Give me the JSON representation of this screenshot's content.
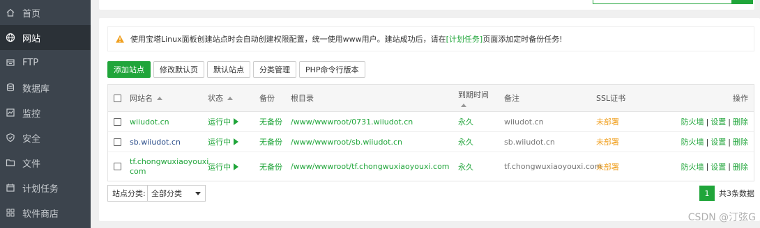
{
  "sidebar": {
    "items": [
      {
        "label": "首页",
        "icon": "home-icon"
      },
      {
        "label": "网站",
        "icon": "globe-icon",
        "active": true
      },
      {
        "label": "FTP",
        "icon": "ftp-icon"
      },
      {
        "label": "数据库",
        "icon": "database-icon"
      },
      {
        "label": "监控",
        "icon": "monitor-icon"
      },
      {
        "label": "安全",
        "icon": "shield-icon"
      },
      {
        "label": "文件",
        "icon": "folder-icon"
      },
      {
        "label": "计划任务",
        "icon": "calendar-icon"
      },
      {
        "label": "软件商店",
        "icon": "grid-icon"
      }
    ]
  },
  "notice": {
    "text_before": "使用宝塔Linux面板创建站点时会自动创建权限配置，统一使用www用户。建站成功后，请在",
    "link": "[计划任务]",
    "text_after": "页面添加定时备份任务!"
  },
  "toolbar": {
    "add_site": "添加站点",
    "edit_default_page": "修改默认页",
    "default_site": "默认站点",
    "category_manage": "分类管理",
    "php_cli_version": "PHP命令行版本"
  },
  "table": {
    "headers": {
      "name": "网站名",
      "status": "状态",
      "backup": "备份",
      "root": "根目录",
      "expire": "到期时间",
      "note": "备注",
      "ssl": "SSL证书",
      "ops": "操作"
    },
    "rows": [
      {
        "name": "wiiudot.cn",
        "status": "运行中",
        "backup": "无备份",
        "root": "/www/wwwroot/0731.wiiudot.cn",
        "expire": "永久",
        "note": "wiiudot.cn",
        "ssl": "未部署",
        "ops": [
          "防火墙",
          "设置",
          "删除"
        ]
      },
      {
        "name": "sb.wiiudot.cn",
        "status": "运行中",
        "backup": "无备份",
        "root": "/www/wwwroot/sb.wiiudot.cn",
        "expire": "永久",
        "note": "sb.wiiudot.cn",
        "ssl": "未部署",
        "ops": [
          "防火墙",
          "设置",
          "删除"
        ]
      },
      {
        "name_line1": "tf.chongwuxiaoyouxi.",
        "name_line2": "com",
        "status": "运行中",
        "backup": "无备份",
        "root": "/www/wwwroot/tf.chongwuxiaoyouxi.com",
        "expire": "永久",
        "note": "tf.chongwuxiaoyouxi.com",
        "ssl": "未部署",
        "ops": [
          "防火墙",
          "设置",
          "删除"
        ]
      }
    ]
  },
  "footer": {
    "category_label": "站点分类:",
    "category_selected": "全部分类",
    "page": "1",
    "total": "共3条数据"
  },
  "watermark": "CSDN @汀弦G",
  "colors": {
    "accent": "#20a53a",
    "sidebar_bg": "#3c444d",
    "warning": "#f0a020"
  }
}
